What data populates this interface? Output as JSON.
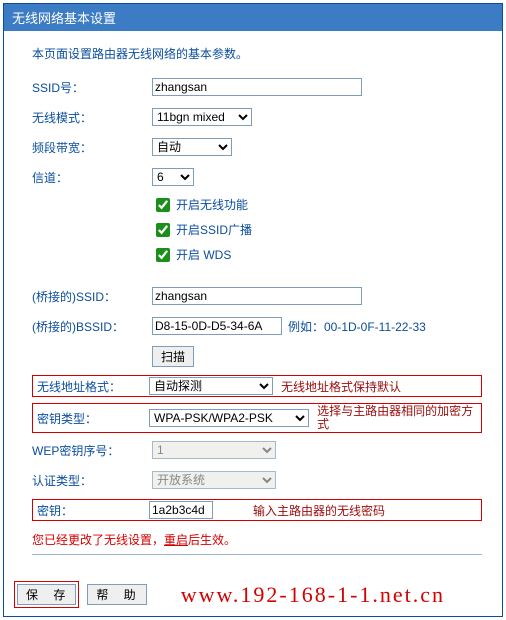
{
  "header": {
    "title": "无线网络基本设置"
  },
  "intro": "本页面设置路由器无线网络的基本参数。",
  "labels": {
    "ssid": "SSID号：",
    "mode": "无线模式：",
    "bandwidth": "频段带宽：",
    "channel": "信道：",
    "enableWireless": "开启无线功能",
    "enableSSID": "开启SSID广播",
    "enableWDS": "开启 WDS",
    "bridgeSSID": "(桥接的)SSID：",
    "bridgeBSSID": "(桥接的)BSSID：",
    "bssidExample": "例如：00-1D-0F-11-22-33",
    "scan": "扫描",
    "wirelessAddr": "无线地址格式：",
    "keyType": "密钥类型：",
    "wepIndex": "WEP密钥序号：",
    "authType": "认证类型：",
    "key": "密钥："
  },
  "values": {
    "ssid": "zhangsan",
    "mode": "11bgn mixed",
    "bandwidth": "自动",
    "channel": "6",
    "enableWireless": true,
    "enableSSID": true,
    "enableWDS": true,
    "bridgeSSID": "zhangsan",
    "bridgeBSSID": "D8-15-0D-D5-34-6A",
    "wirelessAddr": "自动探测",
    "keyType": "WPA-PSK/WPA2-PSK",
    "wepIndex": "1",
    "authType": "开放系统",
    "key": "1a2b3c4d"
  },
  "notes": {
    "wirelessAddr": "无线地址格式保持默认",
    "keyType": "选择与主路由器相同的加密方式",
    "key": "输入主路由器的无线密码"
  },
  "status": {
    "prefix": "您已经更改了无线设置，",
    "link": "重启",
    "suffix": "后生效。"
  },
  "buttons": {
    "save": "保 存",
    "help": "帮 助"
  },
  "watermark": "www.192-168-1-1.net.cn"
}
